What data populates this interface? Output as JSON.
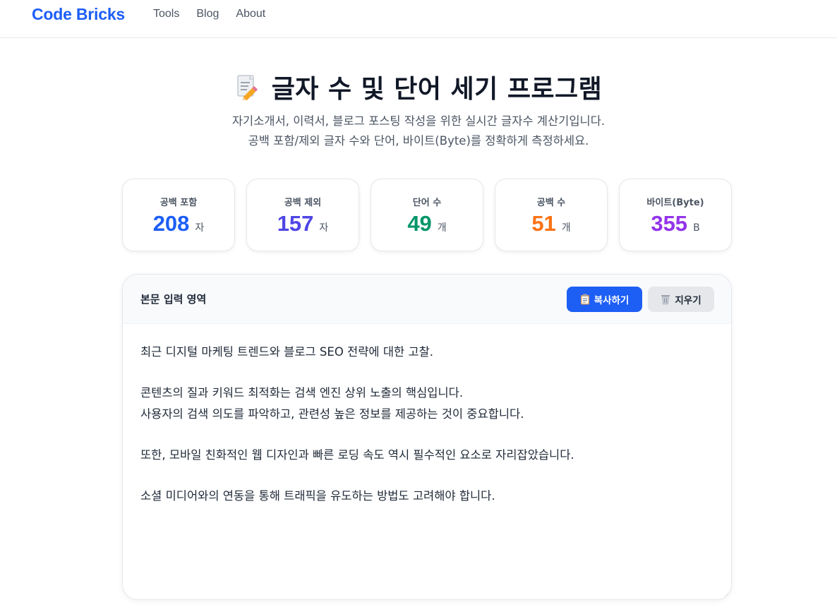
{
  "nav": {
    "brand": "Code Bricks",
    "links": [
      "Tools",
      "Blog",
      "About"
    ],
    "brand_color": "#1d5ef5"
  },
  "hero": {
    "icon": "memo-icon",
    "title": "글자 수 및 단어 세기 프로그램",
    "subtitle_line1": "자기소개서, 이력서, 블로그 포스팅 작성을 위한 실시간 글자수 계산기입니다.",
    "subtitle_line2": "공백 포함/제외 글자 수와 단어, 바이트(Byte)를 정확하게 측정하세요."
  },
  "stats": [
    {
      "label": "공백 포함",
      "value": "208",
      "unit": "자",
      "color": "#1d5ef5"
    },
    {
      "label": "공백 제외",
      "value": "157",
      "unit": "자",
      "color": "#4f46e5"
    },
    {
      "label": "단어 수",
      "value": "49",
      "unit": "개",
      "color": "#059669"
    },
    {
      "label": "공백 수",
      "value": "51",
      "unit": "개",
      "color": "#f97316"
    },
    {
      "label": "바이트(Byte)",
      "value": "355",
      "unit": "B",
      "color": "#9333ea"
    }
  ],
  "editor": {
    "title": "본문 입력 영역",
    "copy_label": "복사하기",
    "copy_icon": "clipboard-icon",
    "clear_label": "지우기",
    "clear_icon": "trash-icon",
    "content": "최근 디지털 마케팅 트렌드와 블로그 SEO 전략에 대한 고찰.\n\n콘텐츠의 질과 키워드 최적화는 검색 엔진 상위 노출의 핵심입니다.\n사용자의 검색 의도를 파악하고, 관련성 높은 정보를 제공하는 것이 중요합니다.\n\n또한, 모바일 친화적인 웹 디자인과 빠른 로딩 속도 역시 필수적인 요소로 자리잡았습니다.\n\n소셜 미디어와의 연동을 통해 트래픽을 유도하는 방법도 고려해야 합니다."
  }
}
